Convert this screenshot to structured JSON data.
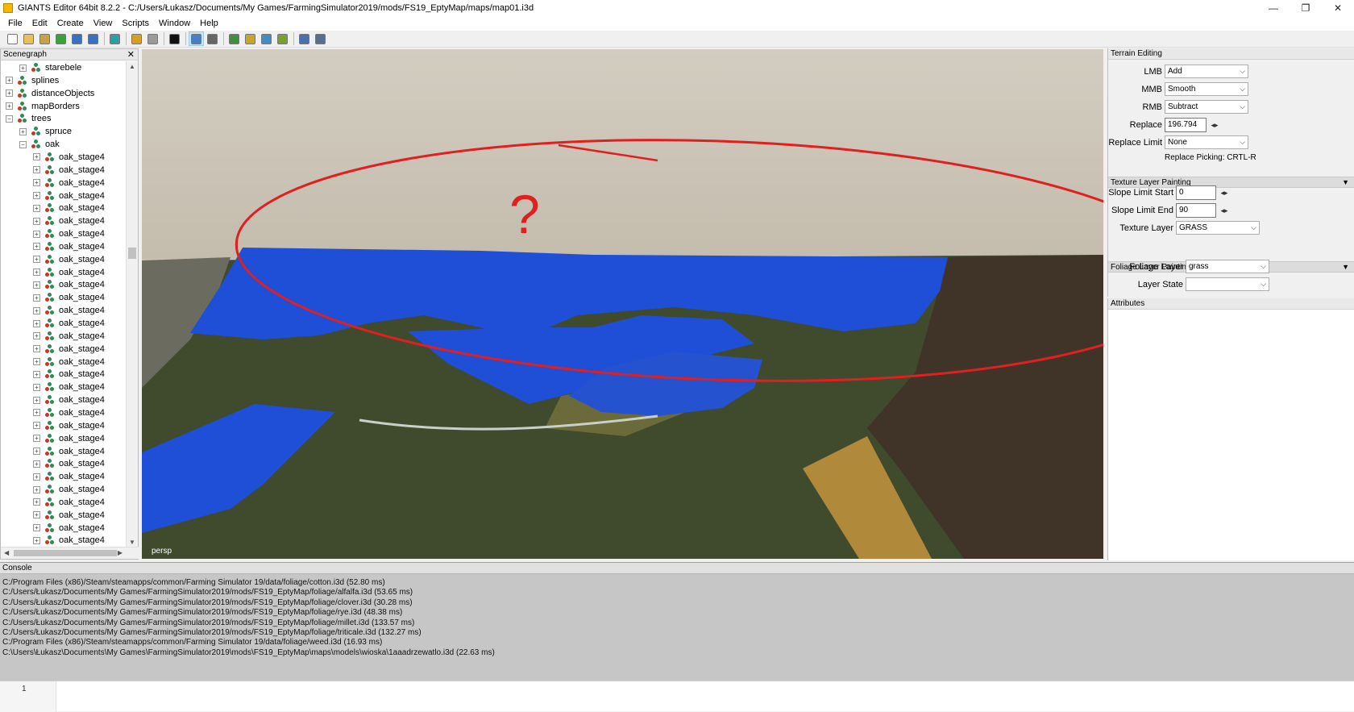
{
  "window": {
    "title": "GIANTS Editor 64bit 8.2.2 - C:/Users/Łukasz/Documents/My Games/FarmingSimulator2019/mods/FS19_EptyMap/maps/map01.i3d",
    "controls": [
      "—",
      "❐",
      "✕"
    ]
  },
  "menu": {
    "items": [
      "File",
      "Edit",
      "Create",
      "View",
      "Scripts",
      "Window",
      "Help"
    ]
  },
  "toolbar": {
    "buttons": [
      {
        "icon": "new-file-icon",
        "color": "#ffffff"
      },
      {
        "icon": "open-folder-icon",
        "color": "#e8c15a"
      },
      {
        "icon": "edit-icon",
        "color": "#c8a24a"
      },
      {
        "icon": "refresh-icon",
        "color": "#3aa23a"
      },
      {
        "icon": "save-icon",
        "color": "#3a6fc1"
      },
      {
        "icon": "save-as-icon",
        "color": "#3a6fc1"
      },
      {
        "icon": "import-icon",
        "color": "#2f9e9e"
      },
      {
        "icon": "undo-icon",
        "color": "#d6a020"
      },
      {
        "icon": "redo-icon",
        "color": "#9a9a9a"
      },
      {
        "icon": "play-icon",
        "color": "#111111"
      },
      {
        "icon": "select-icon",
        "color": "#4a7fc7"
      },
      {
        "icon": "magnet-icon",
        "color": "#666666"
      },
      {
        "icon": "terrain-sculpt-icon",
        "color": "#3f8f3f"
      },
      {
        "icon": "terrain-paint-icon",
        "color": "#c9a62b"
      },
      {
        "icon": "foliage-paint-icon",
        "color": "#3f8fc7"
      },
      {
        "icon": "tree-plant-icon",
        "color": "#7aa12f"
      },
      {
        "icon": "settings-icon",
        "color": "#4a6fae"
      },
      {
        "icon": "tools-icon",
        "color": "#5a6f8e"
      }
    ]
  },
  "scenegraph": {
    "title": "Scenegraph",
    "close": "✕",
    "items": [
      {
        "label": "starebele",
        "depth": 1,
        "expander": "+"
      },
      {
        "label": "splines",
        "depth": 0,
        "expander": "+"
      },
      {
        "label": "distanceObjects",
        "depth": 0,
        "expander": "+"
      },
      {
        "label": "mapBorders",
        "depth": 0,
        "expander": "+"
      },
      {
        "label": "trees",
        "depth": 0,
        "expander": "−"
      },
      {
        "label": "spruce",
        "depth": 1,
        "expander": "+"
      },
      {
        "label": "oak",
        "depth": 1,
        "expander": "−"
      },
      {
        "label": "oak_stage4",
        "depth": 2,
        "expander": "+"
      },
      {
        "label": "oak_stage4",
        "depth": 2,
        "expander": "+"
      },
      {
        "label": "oak_stage4",
        "depth": 2,
        "expander": "+"
      },
      {
        "label": "oak_stage4",
        "depth": 2,
        "expander": "+"
      },
      {
        "label": "oak_stage4",
        "depth": 2,
        "expander": "+"
      },
      {
        "label": "oak_stage4",
        "depth": 2,
        "expander": "+"
      },
      {
        "label": "oak_stage4",
        "depth": 2,
        "expander": "+"
      },
      {
        "label": "oak_stage4",
        "depth": 2,
        "expander": "+"
      },
      {
        "label": "oak_stage4",
        "depth": 2,
        "expander": "+"
      },
      {
        "label": "oak_stage4",
        "depth": 2,
        "expander": "+"
      },
      {
        "label": "oak_stage4",
        "depth": 2,
        "expander": "+"
      },
      {
        "label": "oak_stage4",
        "depth": 2,
        "expander": "+"
      },
      {
        "label": "oak_stage4",
        "depth": 2,
        "expander": "+"
      },
      {
        "label": "oak_stage4",
        "depth": 2,
        "expander": "+"
      },
      {
        "label": "oak_stage4",
        "depth": 2,
        "expander": "+"
      },
      {
        "label": "oak_stage4",
        "depth": 2,
        "expander": "+"
      },
      {
        "label": "oak_stage4",
        "depth": 2,
        "expander": "+"
      },
      {
        "label": "oak_stage4",
        "depth": 2,
        "expander": "+"
      },
      {
        "label": "oak_stage4",
        "depth": 2,
        "expander": "+"
      },
      {
        "label": "oak_stage4",
        "depth": 2,
        "expander": "+"
      },
      {
        "label": "oak_stage4",
        "depth": 2,
        "expander": "+"
      },
      {
        "label": "oak_stage4",
        "depth": 2,
        "expander": "+"
      },
      {
        "label": "oak_stage4",
        "depth": 2,
        "expander": "+"
      },
      {
        "label": "oak_stage4",
        "depth": 2,
        "expander": "+"
      },
      {
        "label": "oak_stage4",
        "depth": 2,
        "expander": "+"
      },
      {
        "label": "oak_stage4",
        "depth": 2,
        "expander": "+"
      },
      {
        "label": "oak_stage4",
        "depth": 2,
        "expander": "+"
      },
      {
        "label": "oak_stage4",
        "depth": 2,
        "expander": "+"
      },
      {
        "label": "oak_stage4",
        "depth": 2,
        "expander": "+"
      },
      {
        "label": "oak_stage4",
        "depth": 2,
        "expander": "+"
      },
      {
        "label": "oak_stage4",
        "depth": 2,
        "expander": "+"
      },
      {
        "label": "oak_stage4",
        "depth": 2,
        "expander": "+"
      },
      {
        "label": "oak_stage4",
        "depth": 2,
        "expander": "+"
      },
      {
        "label": "oak_stage4",
        "depth": 2,
        "expander": "+"
      }
    ]
  },
  "viewport": {
    "camera_label": "persp",
    "annotation": "?",
    "colors": {
      "sky": "#cbc4b6",
      "field": "#1e4fd6",
      "grass": "#3d4a2b",
      "annotation": "#e02020"
    }
  },
  "terrain_editing": {
    "title": "Terrain Editing",
    "lmb": {
      "label": "LMB",
      "value": "Add"
    },
    "mmb": {
      "label": "MMB",
      "value": "Smooth"
    },
    "rmb": {
      "label": "RMB",
      "value": "Subtract"
    },
    "replace": {
      "label": "Replace",
      "value": "196.794"
    },
    "replace_limit": {
      "label": "Replace Limit",
      "value": "None"
    },
    "replace_picking": "Replace Picking: CRTL-R"
  },
  "texture_layer_painting": {
    "title": "Texture Layer Painting",
    "slope_start": {
      "label": "Slope Limit Start",
      "value": "0"
    },
    "slope_end": {
      "label": "Slope Limit End",
      "value": "90"
    },
    "texture_layer": {
      "label": "Texture Layer",
      "value": "GRASS"
    }
  },
  "foliage_layer_painting": {
    "title": "Foliage Layer Painting",
    "foliage_layer": {
      "label": "Foliage Layer",
      "value": "grass"
    },
    "layer_state": {
      "label": "Layer State",
      "value": ""
    }
  },
  "attributes": {
    "title": "Attributes"
  },
  "console": {
    "title": "Console",
    "lines": [
      "C:/Program Files (x86)/Steam/steamapps/common/Farming Simulator 19/data/foliage/cotton.i3d (52.80 ms)",
      "C:/Users/Łukasz/Documents/My Games/FarmingSimulator2019/mods/FS19_EptyMap/foliage/alfalfa.i3d (53.65 ms)",
      "C:/Users/Łukasz/Documents/My Games/FarmingSimulator2019/mods/FS19_EptyMap/foliage/clover.i3d (30.28 ms)",
      "C:/Users/Łukasz/Documents/My Games/FarmingSimulator2019/mods/FS19_EptyMap/foliage/rye.i3d (48.38 ms)",
      "C:/Users/Łukasz/Documents/My Games/FarmingSimulator2019/mods/FS19_EptyMap/foliage/millet.i3d (133.57 ms)",
      "C:/Users/Łukasz/Documents/My Games/FarmingSimulator2019/mods/FS19_EptyMap/foliage/triticale.i3d (132.27 ms)",
      "C:/Program Files (x86)/Steam/steamapps/common/Farming Simulator 19/data/foliage/weed.i3d (16.93 ms)",
      "C:\\Users\\Łukasz\\Documents\\My Games\\FarmingSimulator2019\\mods\\FS19_EptyMap\\maps\\models\\wioska\\1aaadrzewatlo.i3d (22.63 ms)"
    ],
    "input_line_number": "1"
  }
}
